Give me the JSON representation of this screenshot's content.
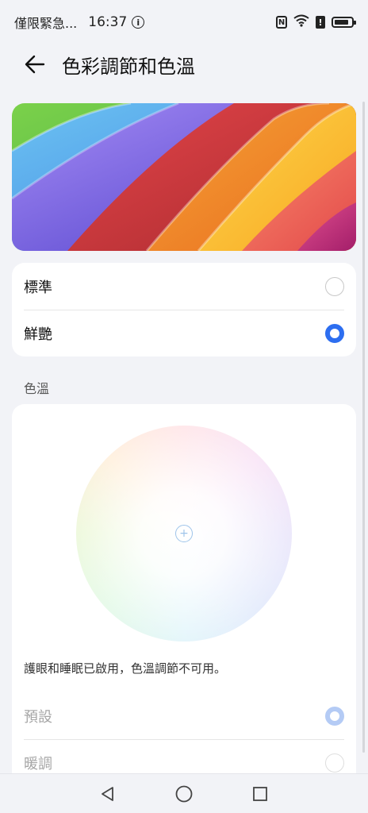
{
  "status_bar": {
    "carrier": "僅限緊急...",
    "time": "16:37",
    "icons": [
      "info-icon",
      "nfc-icon",
      "wifi-icon",
      "alert-icon",
      "battery-icon"
    ],
    "battery_level": 0.85
  },
  "header": {
    "back_icon": "arrow-left-icon",
    "title": "色彩調節和色溫"
  },
  "display_mode": {
    "options": [
      {
        "label": "標準",
        "selected": false
      },
      {
        "label": "鮮艷",
        "selected": true
      }
    ]
  },
  "color_temperature": {
    "section_title": "色溫",
    "note": "護眼和睡眠已啟用，色溫調節不可用。",
    "options": [
      {
        "label": "預設",
        "selected": true,
        "disabled": true
      },
      {
        "label": "暖調",
        "selected": false,
        "disabled": true
      }
    ]
  },
  "colors": {
    "accent": "#2d6ef0",
    "background": "#f2f3f7",
    "card": "#ffffff"
  },
  "nav_bar": {
    "icons": [
      "back-triangle-icon",
      "home-circle-icon",
      "recents-square-icon"
    ]
  }
}
